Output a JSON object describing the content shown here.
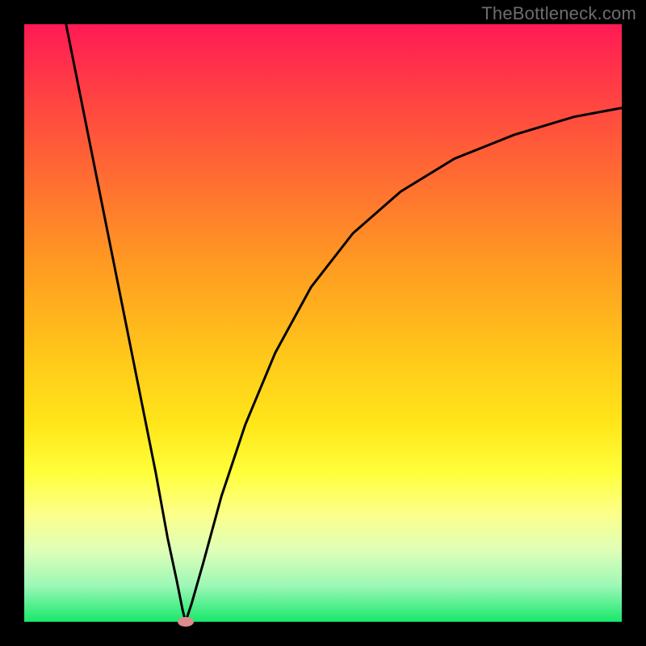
{
  "watermark": "TheBottleneck.com",
  "colors": {
    "frame": "#000000",
    "curve": "#000000",
    "dot": "#de8b8d"
  },
  "chart_data": {
    "type": "line",
    "title": "",
    "xlabel": "",
    "ylabel": "",
    "xlim": [
      0,
      100
    ],
    "ylim": [
      0,
      100
    ],
    "grid": false,
    "legend": false,
    "series": [
      {
        "name": "left-branch",
        "x": [
          7,
          10,
          13,
          16,
          19,
          22,
          24,
          25.5,
          26.5,
          27
        ],
        "y": [
          100,
          85,
          70,
          55,
          40,
          25,
          14,
          7,
          2,
          0
        ]
      },
      {
        "name": "right-branch",
        "x": [
          27,
          28,
          30,
          33,
          37,
          42,
          48,
          55,
          63,
          72,
          82,
          92,
          100
        ],
        "y": [
          0,
          3,
          10,
          21,
          33,
          45,
          56,
          65,
          72,
          77.5,
          81.5,
          84.5,
          86
        ]
      }
    ],
    "annotations": [
      {
        "name": "minimum-dot",
        "x": 27,
        "y": 0
      }
    ]
  }
}
